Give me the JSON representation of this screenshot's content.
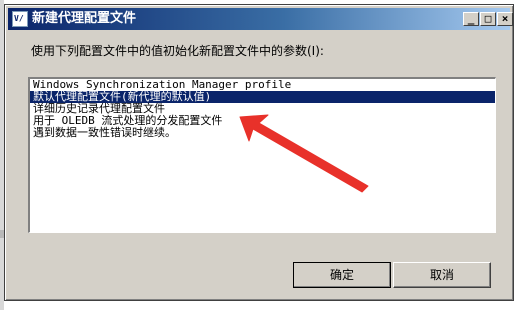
{
  "window": {
    "title": "新建代理配置文件",
    "icon": "app-icon",
    "controls": [
      "_",
      "□",
      "×"
    ]
  },
  "dialog": {
    "instruction": "使用下列配置文件中的值初始化新配置文件中的参数(I):",
    "list_items": [
      "Windows Synchronization Manager profile",
      "默认代理配置文件(新代理的默认值)",
      "详细历史记录代理配置文件",
      "用于 OLEDB 流式处理的分发配置文件",
      "遇到数据一致性错误时继续。"
    ],
    "selected_index": 1
  },
  "buttons": {
    "ok": "确定",
    "cancel": "取消"
  },
  "colors": {
    "selection": "#0a246a",
    "annotation_arrow": "#e8312a"
  }
}
